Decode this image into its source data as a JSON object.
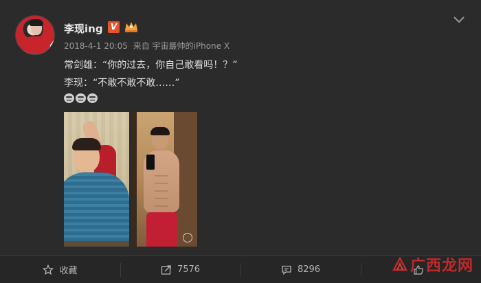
{
  "post": {
    "username": "李现ing",
    "verified_badge": "V",
    "timestamp": "2018-4-1 20:05",
    "source": "来自 宇宙最帅的iPhone X",
    "lines": [
      "常剑雄：“你的过去，你自己敢看吗！？”",
      "李现：“不敢不敢不敢……”"
    ],
    "emoji_count": 3
  },
  "icons": {
    "avatar": "avatar",
    "verified": "verified-v-icon",
    "member_crown": "crown-icon",
    "menu": "chevron-down-icon",
    "favorite": "star-icon",
    "repost": "share-icon",
    "comment": "comment-icon",
    "like": "thumbs-up-icon"
  },
  "actions": [
    {
      "label": "收藏",
      "icon": "star-icon"
    },
    {
      "label": "7576",
      "icon": "share-icon"
    },
    {
      "label": "8296",
      "icon": "comment-icon"
    },
    {
      "label": "",
      "icon": "thumbs-up-icon"
    }
  ],
  "watermark": {
    "text": "广西龙网"
  },
  "colors": {
    "background": "#2b2b2b",
    "accent": "#e8542a",
    "watermark": "#c02a2a"
  }
}
